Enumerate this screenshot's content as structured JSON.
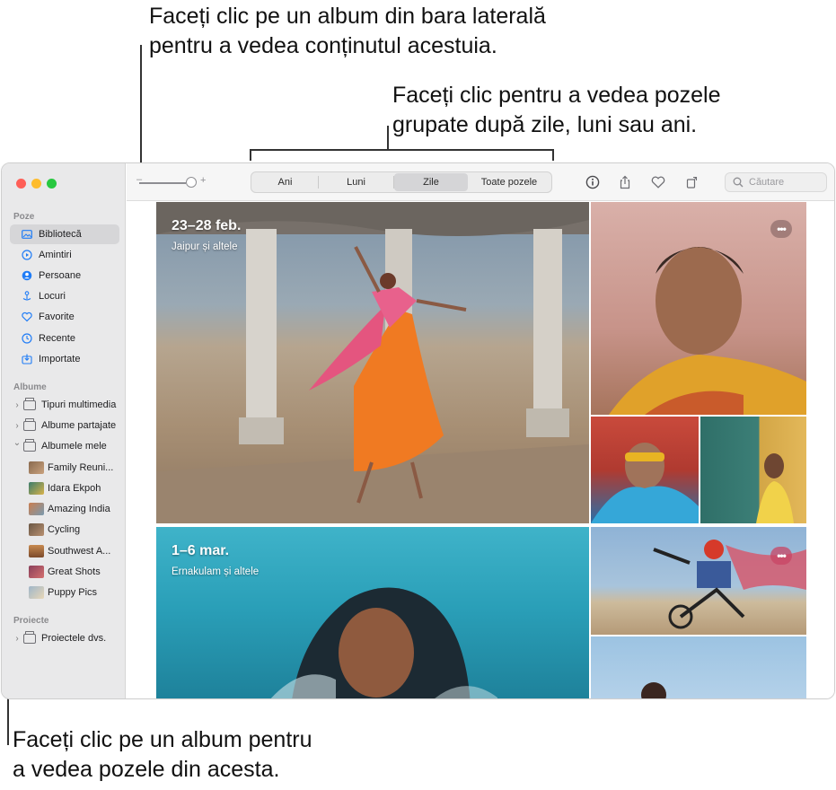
{
  "callouts": {
    "sidebar": [
      "Faceți clic pe un album din bara laterală",
      "pentru a vedea conținutul acestuia."
    ],
    "grouping": [
      "Faceți clic pentru a vedea pozele",
      "grupate după zile, luni sau ani."
    ],
    "album": [
      "Faceți clic pe un album pentru",
      "a vedea pozele din acesta."
    ]
  },
  "sidebar": {
    "photos_header": "Poze",
    "photos_items": [
      {
        "label": "Bibliotecă",
        "icon": "library-icon",
        "selected": true
      },
      {
        "label": "Amintiri",
        "icon": "memories-icon"
      },
      {
        "label": "Persoane",
        "icon": "people-icon"
      },
      {
        "label": "Locuri",
        "icon": "places-icon"
      },
      {
        "label": "Favorite",
        "icon": "heart-icon"
      },
      {
        "label": "Recente",
        "icon": "clock-icon"
      },
      {
        "label": "Importate",
        "icon": "import-icon"
      }
    ],
    "albums_header": "Albume",
    "album_groups": [
      {
        "label": "Tipuri multimedia",
        "icon": "folder-icon",
        "chevron": "›"
      },
      {
        "label": "Albume partajate",
        "icon": "shared-albums-icon",
        "chevron": "›"
      },
      {
        "label": "Albumele mele",
        "icon": "folder-icon",
        "chevron": "⌄"
      }
    ],
    "my_albums": [
      {
        "label": "Family Reuni...",
        "thumb": "#8a6a4e"
      },
      {
        "label": "Idara Ekpoh",
        "thumb": "#3b7d6b"
      },
      {
        "label": "Amazing India",
        "thumb": "#c97d4f"
      },
      {
        "label": "Cycling",
        "thumb": "#6a5745"
      },
      {
        "label": "Southwest A...",
        "thumb": "#a86b3d"
      },
      {
        "label": "Great Shots",
        "thumb": "#8a3f5a"
      },
      {
        "label": "Puppy Pics",
        "thumb": "#9fb6c9"
      }
    ],
    "projects_header": "Proiecte",
    "projects_items": [
      {
        "label": "Proiectele dvs.",
        "icon": "folder-icon",
        "chevron": "›"
      }
    ]
  },
  "toolbar": {
    "zoom_minus": "–",
    "zoom_plus": "+",
    "zoom_level": 1.0,
    "segments": [
      {
        "label": "Ani",
        "active": false
      },
      {
        "label": "Luni",
        "active": false
      },
      {
        "label": "Zile",
        "active": true
      },
      {
        "label": "Toate pozele",
        "active": false
      }
    ],
    "icons": [
      "info-icon",
      "share-icon",
      "heart-icon",
      "rotate-icon"
    ],
    "search_placeholder": "Căutare"
  },
  "grid": {
    "groups": [
      {
        "date": "23–28 feb.",
        "place": "Jaipur și altele"
      },
      {
        "date": "1–6 mar.",
        "place": "Ernakulam și altele"
      }
    ],
    "more_label": "•••"
  }
}
